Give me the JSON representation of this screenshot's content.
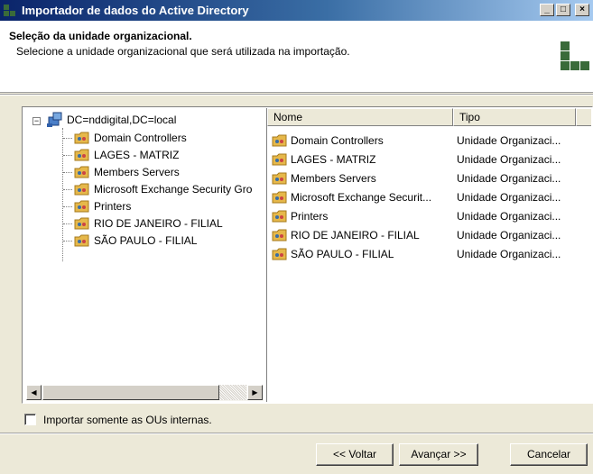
{
  "window": {
    "title": "Importador de dados do Active Directory",
    "minimize_glyph": "_",
    "maximize_glyph": "□",
    "close_glyph": "×"
  },
  "header": {
    "title": "Seleção da unidade organizacional.",
    "subtitle": "Selecione a unidade organizacional que será utilizada na importação."
  },
  "tree": {
    "expander_glyph": "−",
    "root_label": "DC=nddigital,DC=local",
    "root_icon": "domain-icon",
    "items": [
      {
        "label": "Domain Controllers",
        "icon": "ou-folder-icon"
      },
      {
        "label": "LAGES - MATRIZ",
        "icon": "ou-folder-icon"
      },
      {
        "label": "Members Servers",
        "icon": "ou-folder-icon"
      },
      {
        "label": "Microsoft Exchange Security Gro",
        "icon": "ou-folder-icon"
      },
      {
        "label": "Printers",
        "icon": "ou-folder-icon"
      },
      {
        "label": "RIO DE JANEIRO - FILIAL",
        "icon": "ou-folder-icon"
      },
      {
        "label": "SÃO PAULO - FILIAL",
        "icon": "ou-folder-icon"
      }
    ],
    "scroll_left_glyph": "◀",
    "scroll_right_glyph": "▶"
  },
  "list": {
    "columns": [
      "Nome",
      "Tipo"
    ],
    "rows": [
      {
        "nome": "Domain Controllers",
        "tipo": "Unidade Organizaci..."
      },
      {
        "nome": "LAGES - MATRIZ",
        "tipo": "Unidade Organizaci..."
      },
      {
        "nome": "Members Servers",
        "tipo": "Unidade Organizaci..."
      },
      {
        "nome": "Microsoft Exchange Securit...",
        "tipo": "Unidade Organizaci..."
      },
      {
        "nome": "Printers",
        "tipo": "Unidade Organizaci..."
      },
      {
        "nome": "RIO DE JANEIRO - FILIAL",
        "tipo": "Unidade Organizaci..."
      },
      {
        "nome": "SÃO PAULO - FILIAL",
        "tipo": "Unidade Organizaci..."
      }
    ]
  },
  "options": {
    "internal_ous_label": "Importar somente as OUs internas.",
    "internal_ous_checked": false
  },
  "buttons": {
    "back": "<< Voltar",
    "next": "Avançar >>",
    "cancel": "Cancelar"
  },
  "colors": {
    "title_bar": "#0a246a",
    "logo": "#3a6b3a",
    "ou_folder": "#e6b84a"
  }
}
